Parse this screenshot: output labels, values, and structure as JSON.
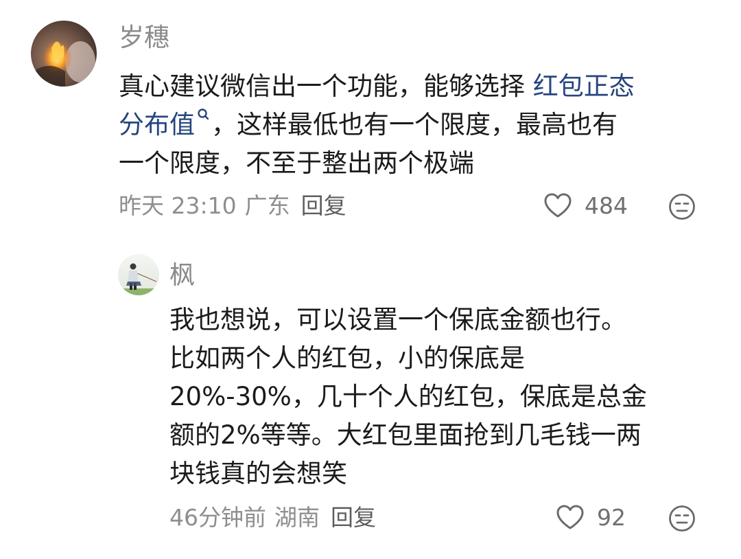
{
  "comments": [
    {
      "username": "岁穗",
      "text_lines": [
        {
          "before": "真心建议微信出一个功能，能够选择 ",
          "link": "红包正态"
        },
        {
          "link": "分布值",
          "after": "，这样最低也有一个限度，最高也有"
        },
        {
          "text": "一个限度，不至于整出两个极端"
        }
      ],
      "time": "昨天 23:10",
      "region": "广东",
      "reply_label": "回复",
      "likes": "484",
      "avatar_icon": "fire-avatar"
    },
    {
      "username": "枫",
      "text_lines": [
        "我也想说，可以设置一个保底金额也行。",
        "比如两个人的红包，小的保底是",
        "20%-30%，几十个人的红包，保底是总金",
        "额的2%等等。大红包里面抢到几毛钱一两",
        "块钱真的会想笑"
      ],
      "time": "46分钟前",
      "region": "湖南",
      "reply_label": "回复",
      "likes": "92",
      "avatar_icon": "fishing-person-avatar"
    }
  ],
  "icons": {
    "like": "heart-outline-icon",
    "dislike": "meh-face-icon",
    "search_hint": "search-icon"
  },
  "colors": {
    "link": "#27457e",
    "username": "#8a8a8a",
    "meta": "#8e8e8e"
  }
}
